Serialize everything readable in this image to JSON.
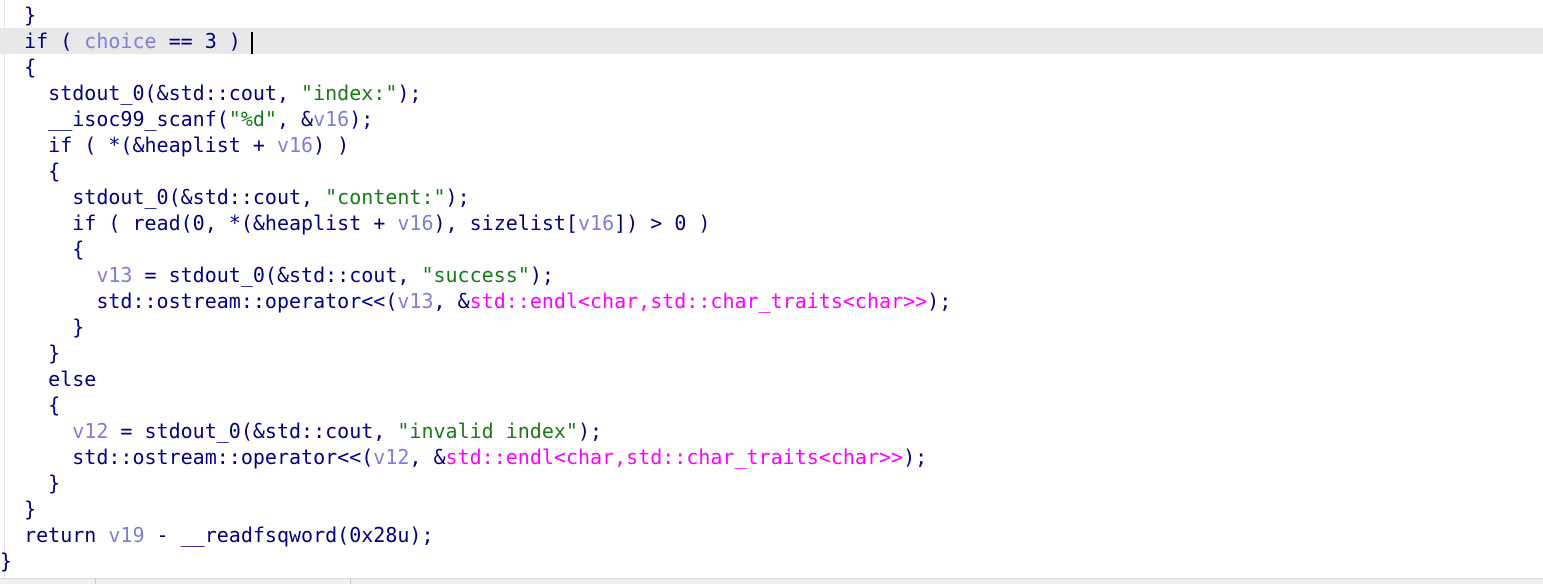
{
  "code": {
    "current_line": 1,
    "lines": [
      [
        [
          "pl",
          "  }"
        ]
      ],
      [
        [
          "kw",
          "  if ( "
        ],
        [
          "var",
          "choice"
        ],
        [
          "pl",
          " == 3 )"
        ]
      ],
      [
        [
          "pl",
          "  {"
        ]
      ],
      [
        [
          "pl",
          "    stdout_0(&std::cout, "
        ],
        [
          "str",
          "\"index:\""
        ],
        [
          "pl",
          ");"
        ]
      ],
      [
        [
          "pl",
          "    __isoc99_scanf("
        ],
        [
          "str",
          "\"%d\""
        ],
        [
          "pl",
          ", &"
        ],
        [
          "var",
          "v16"
        ],
        [
          "pl",
          ");"
        ]
      ],
      [
        [
          "pl",
          "    if ( *(&heaplist + "
        ],
        [
          "var",
          "v16"
        ],
        [
          "pl",
          ") )"
        ]
      ],
      [
        [
          "pl",
          "    {"
        ]
      ],
      [
        [
          "pl",
          "      stdout_0(&std::cout, "
        ],
        [
          "str",
          "\"content:\""
        ],
        [
          "pl",
          ");"
        ]
      ],
      [
        [
          "pl",
          "      if ( read(0, *(&heaplist + "
        ],
        [
          "var",
          "v16"
        ],
        [
          "pl",
          "), sizelist["
        ],
        [
          "var",
          "v16"
        ],
        [
          "pl",
          "]) > 0 )"
        ]
      ],
      [
        [
          "pl",
          "      {"
        ]
      ],
      [
        [
          "pl",
          "        "
        ],
        [
          "var",
          "v13"
        ],
        [
          "pl",
          " = stdout_0(&std::cout, "
        ],
        [
          "str",
          "\"success\""
        ],
        [
          "pl",
          ");"
        ]
      ],
      [
        [
          "pl",
          "        std::ostream::operator<<("
        ],
        [
          "var",
          "v13"
        ],
        [
          "pl",
          ", &"
        ],
        [
          "imp",
          "std::endl<char,std::char_traits<char>>"
        ],
        [
          "pl",
          ");"
        ]
      ],
      [
        [
          "pl",
          "      }"
        ]
      ],
      [
        [
          "pl",
          "    }"
        ]
      ],
      [
        [
          "pl",
          "    else"
        ]
      ],
      [
        [
          "pl",
          "    {"
        ]
      ],
      [
        [
          "pl",
          "      "
        ],
        [
          "var",
          "v12"
        ],
        [
          "pl",
          " = stdout_0(&std::cout, "
        ],
        [
          "str",
          "\"invalid index\""
        ],
        [
          "pl",
          ");"
        ]
      ],
      [
        [
          "pl",
          "      std::ostream::operator<<("
        ],
        [
          "var",
          "v12"
        ],
        [
          "pl",
          ", &"
        ],
        [
          "imp",
          "std::endl<char,std::char_traits<char>>"
        ],
        [
          "pl",
          ");"
        ]
      ],
      [
        [
          "pl",
          "    }"
        ]
      ],
      [
        [
          "pl",
          "  }"
        ]
      ],
      [
        [
          "pl",
          "  return "
        ],
        [
          "var",
          "v19"
        ],
        [
          "pl",
          " - __readfsqword(0x28u);"
        ]
      ],
      [
        [
          "pl",
          "}"
        ]
      ]
    ]
  },
  "colors": {
    "keyword": "#000080",
    "variable": "#7f7fd6",
    "string": "#1a7a1a",
    "import": "#ff00ff",
    "current_line_bg": "#e8e8e8"
  }
}
